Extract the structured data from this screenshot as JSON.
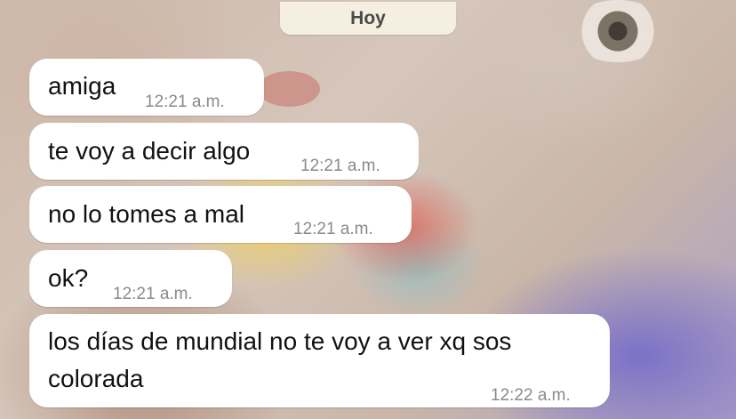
{
  "chat": {
    "date_separator": "Hoy",
    "messages": [
      {
        "text": "amiga",
        "time": "12:21 a.m."
      },
      {
        "text": "te voy a decir algo",
        "time": "12:21 a.m."
      },
      {
        "text": "no lo tomes a mal",
        "time": "12:21 a.m."
      },
      {
        "text": "ok?",
        "time": "12:21 a.m."
      },
      {
        "text_line1": "los días de mundial no te voy a ver xq sos",
        "text_line2": "colorada",
        "time": "12:22 a.m."
      }
    ]
  },
  "colors": {
    "bubble": "#ffffff",
    "date_chip": "#f6f0e3",
    "timestamp": "#8a8a8a",
    "text": "#111111"
  }
}
